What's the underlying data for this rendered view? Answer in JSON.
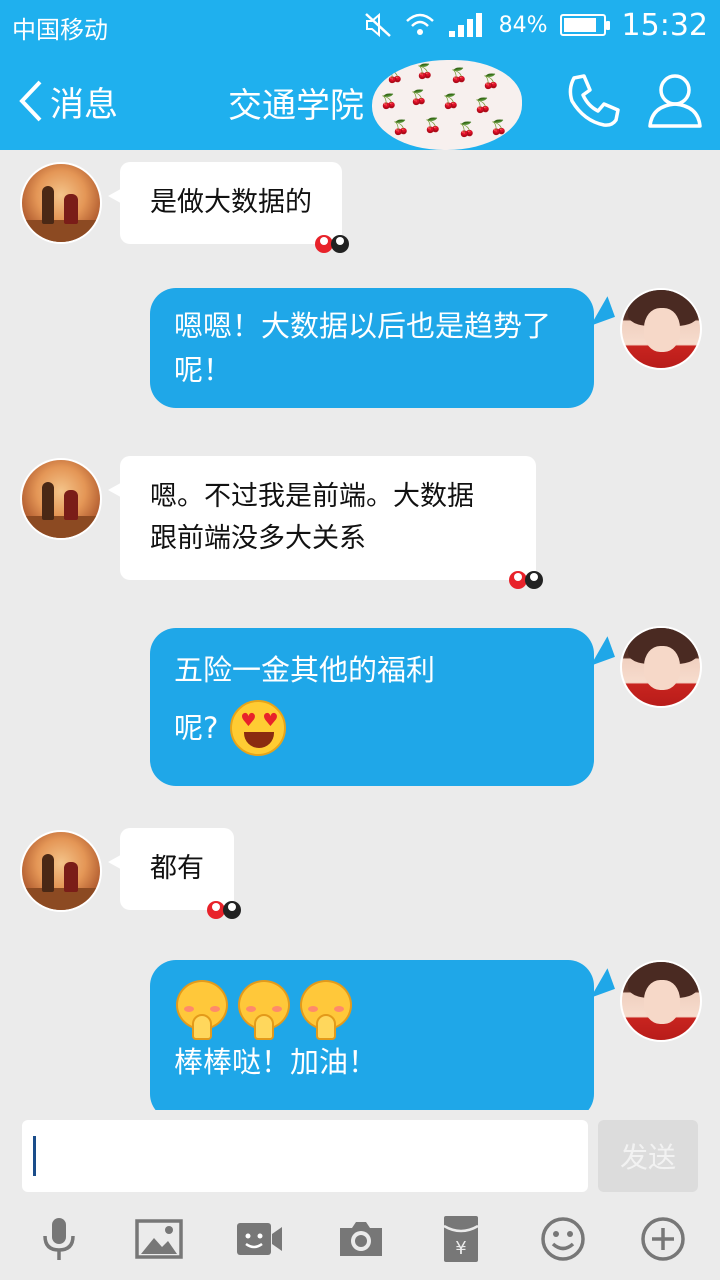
{
  "status_bar": {
    "carrier": "中国移动",
    "battery_pct": "84%",
    "time": "15:32"
  },
  "header": {
    "back_label": "消息",
    "title": "交通学院",
    "accent_color": "#1fb0ee"
  },
  "messages": [
    {
      "side": "left",
      "text": "是做大数据的"
    },
    {
      "side": "right",
      "text": "嗯嗯！大数据以后也是趋势了呢！"
    },
    {
      "side": "left",
      "line1": "嗯。不过我是前端。大数据",
      "line2": "跟前端没多大关系"
    },
    {
      "side": "right",
      "line1": "五险一金其他的福利",
      "line2": "呢?",
      "emoji": "heart-eyes-icon"
    },
    {
      "side": "left",
      "text": "都有"
    },
    {
      "side": "right",
      "text": "棒棒哒！加油！",
      "emoji": "praying-face-icon"
    }
  ],
  "input": {
    "placeholder": "",
    "value": "",
    "send_label": "发送"
  },
  "toolbar": [
    "microphone-icon",
    "image-icon",
    "video-icon",
    "camera-icon",
    "red-packet-icon",
    "emoji-icon",
    "plus-icon"
  ]
}
